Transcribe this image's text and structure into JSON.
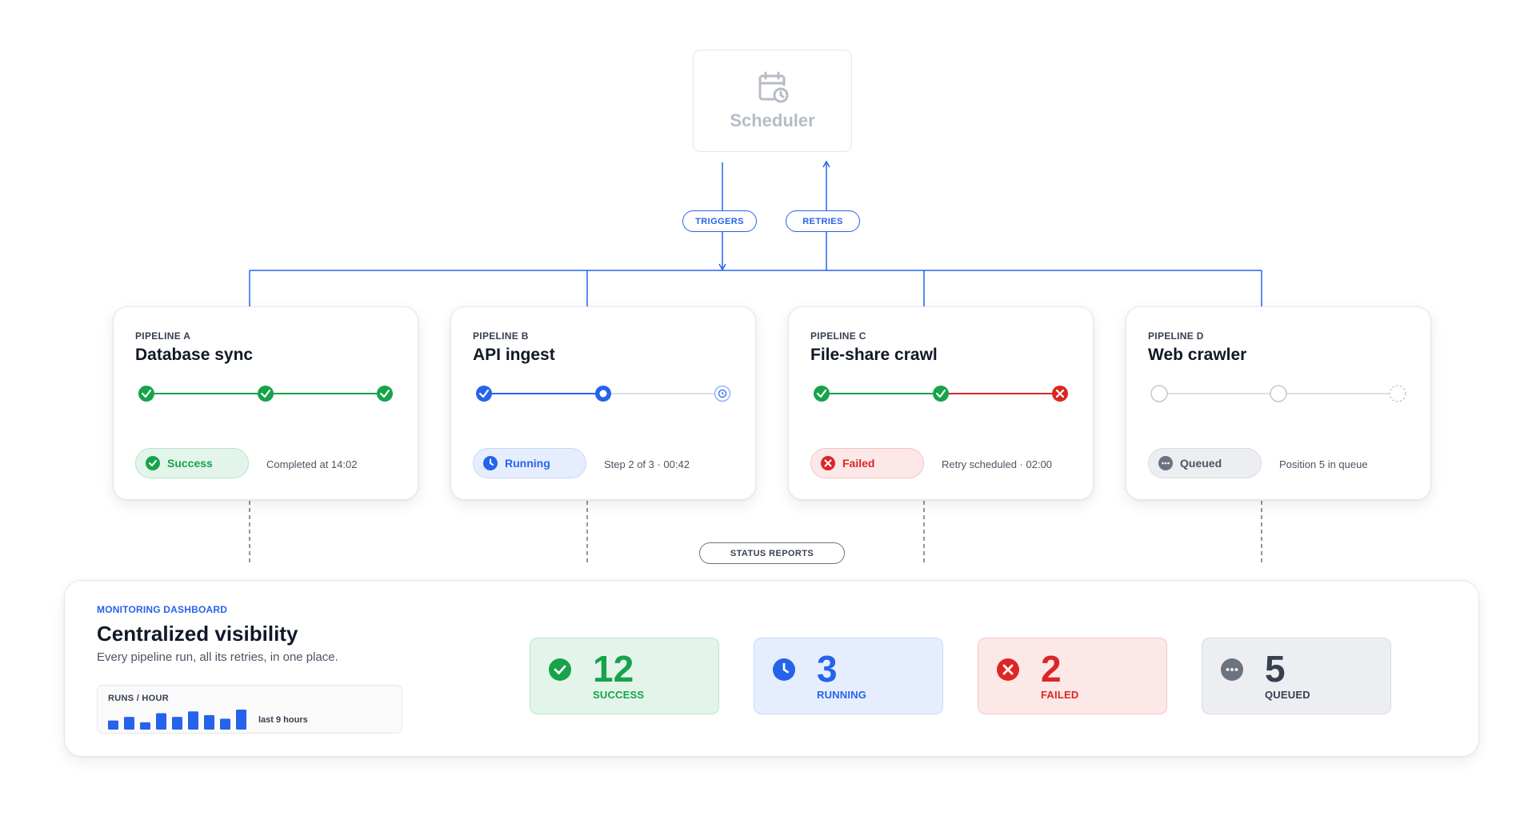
{
  "scheduler": {
    "label": "Scheduler",
    "icon": "calendar-clock-icon"
  },
  "edges": {
    "triggers": "TRIGGERS",
    "retries": "RETRIES",
    "status_reports": "STATUS REPORTS"
  },
  "colors": {
    "accent": "#2563eb",
    "success": "#16a34a",
    "running": "#2563eb",
    "failed": "#dc2626",
    "queued": "#6b7280"
  },
  "pipelines": [
    {
      "kicker": "PIPELINE A",
      "title": "Database sync",
      "status": "Success",
      "status_icon": "check-circle-icon",
      "meta": "Completed at 14:02",
      "steps": [
        "done",
        "done",
        "done"
      ]
    },
    {
      "kicker": "PIPELINE B",
      "title": "API ingest",
      "status": "Running",
      "status_icon": "clock-icon",
      "meta": "Step 2 of 3 · 00:42",
      "steps": [
        "done",
        "active",
        "pending"
      ]
    },
    {
      "kicker": "PIPELINE C",
      "title": "File-share crawl",
      "status": "Failed",
      "status_icon": "x-circle-icon",
      "meta": "Retry scheduled · 02:00",
      "steps": [
        "done",
        "done",
        "failed"
      ]
    },
    {
      "kicker": "PIPELINE D",
      "title": "Web crawler",
      "status": "Queued",
      "status_icon": "ellipsis-circle-icon",
      "meta": "Position 5 in queue",
      "steps": [
        "waiting",
        "waiting",
        "waiting"
      ]
    }
  ],
  "dashboard": {
    "kicker": "MONITORING DASHBOARD",
    "title": "Centralized visibility",
    "subtitle": "Every pipeline run, all its retries, in one place.",
    "runs": {
      "label": "RUNS / HOUR",
      "note": "last 9 hours",
      "values": [
        0.5,
        0.7,
        0.4,
        0.9,
        0.7,
        1.0,
        0.8,
        0.6,
        1.1
      ]
    },
    "stats": [
      {
        "value": "12",
        "label": "SUCCESS",
        "icon": "check-circle-icon"
      },
      {
        "value": "3",
        "label": "RUNNING",
        "icon": "clock-icon"
      },
      {
        "value": "2",
        "label": "FAILED",
        "icon": "x-circle-icon"
      },
      {
        "value": "5",
        "label": "QUEUED",
        "icon": "ellipsis-circle-icon"
      }
    ]
  }
}
